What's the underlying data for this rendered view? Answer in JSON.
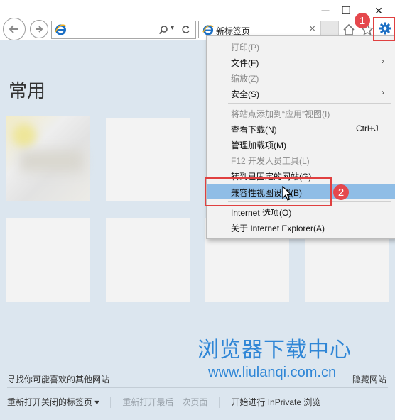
{
  "window": {
    "minimize_symbol": "—",
    "maximize_symbol": "☐",
    "close_symbol": "✕"
  },
  "tab": {
    "label": "新标签页",
    "close_symbol": "×"
  },
  "page": {
    "heading": "常用",
    "footer_find_sites": "寻找你可能喜欢的其他网站",
    "footer_hide_sites": "隐藏网站",
    "bottom_bar": {
      "reopen_closed_tabs": "重新打开关闭的标签页 ▾",
      "reopen_last_session": "重新打开最后一次页面",
      "inprivate": "开始进行 InPrivate 浏览"
    },
    "watermark_title": "浏览器下载中心",
    "watermark_url": "www.liulanqi.com.cn"
  },
  "menu": {
    "items": [
      {
        "label": "打印(P)",
        "disabled": true
      },
      {
        "label": "文件(F)",
        "submenu": true
      },
      {
        "label": "缩放(Z)",
        "disabled": true
      },
      {
        "label": "安全(S)",
        "submenu": true
      },
      {
        "label": "将站点添加到“应用”视图(I)",
        "disabled": true
      },
      {
        "label": "查看下载(N)",
        "shortcut": "Ctrl+J"
      },
      {
        "label": "管理加载项(M)"
      },
      {
        "label": "F12 开发人员工具(L)",
        "disabled": true
      },
      {
        "label": "转到已固定的网站(G)"
      },
      {
        "label": "兼容性视图设置(B)",
        "highlighted": true
      },
      {
        "label": "Internet 选项(O)"
      },
      {
        "label": "关于 Internet Explorer(A)"
      }
    ],
    "submenu_arrow": "›"
  },
  "annotations": {
    "step1": "1",
    "step2": "2"
  },
  "icons": {
    "back": "back-arrow-icon",
    "forward": "forward-arrow-icon",
    "ie": "ie-logo-icon",
    "search": "search-icon",
    "refresh": "refresh-icon",
    "home": "home-icon",
    "favorites": "star-icon",
    "tools": "gear-icon"
  },
  "colors": {
    "accent_blue": "#1c6fc4",
    "page_bg": "#dce6ef",
    "menu_highlight": "#8fbde6",
    "annotation_red": "#e5484d",
    "watermark": "#2f86d6"
  }
}
